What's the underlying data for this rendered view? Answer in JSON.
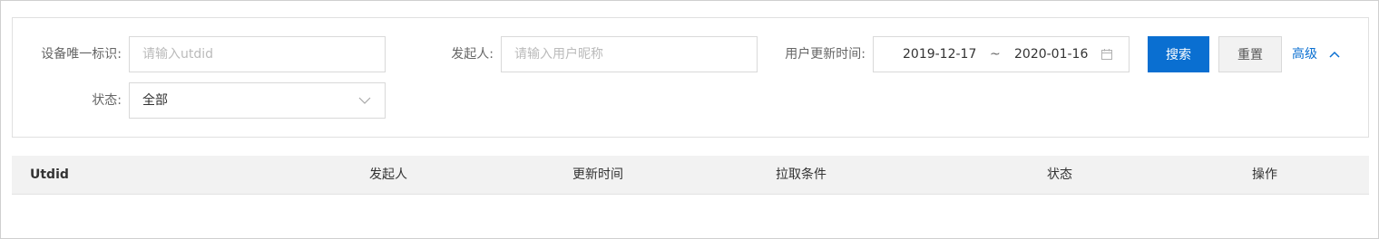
{
  "filters": {
    "utdid": {
      "label": "设备唯一标识:",
      "placeholder": "请输入utdid",
      "value": ""
    },
    "initiator": {
      "label": "发起人:",
      "placeholder": "请输入用户昵称",
      "value": ""
    },
    "update_time": {
      "label": "用户更新时间:",
      "start": "2019-12-17",
      "separator": "~",
      "end": "2020-01-16"
    },
    "status": {
      "label": "状态:",
      "selected": "全部"
    }
  },
  "actions": {
    "search_label": "搜索",
    "reset_label": "重置",
    "advanced_label": "高级"
  },
  "table": {
    "columns": [
      "Utdid",
      "发起人",
      "更新时间",
      "拉取条件",
      "状态",
      "操作"
    ]
  },
  "colors": {
    "primary": "#0a6fd1",
    "header_bg": "#f2f2f2",
    "border": "#d9d9d9"
  },
  "icons": {
    "calendar": "calendar-icon",
    "dropdown": "chevron-down-icon",
    "advanced_toggle": "chevron-up-icon"
  }
}
